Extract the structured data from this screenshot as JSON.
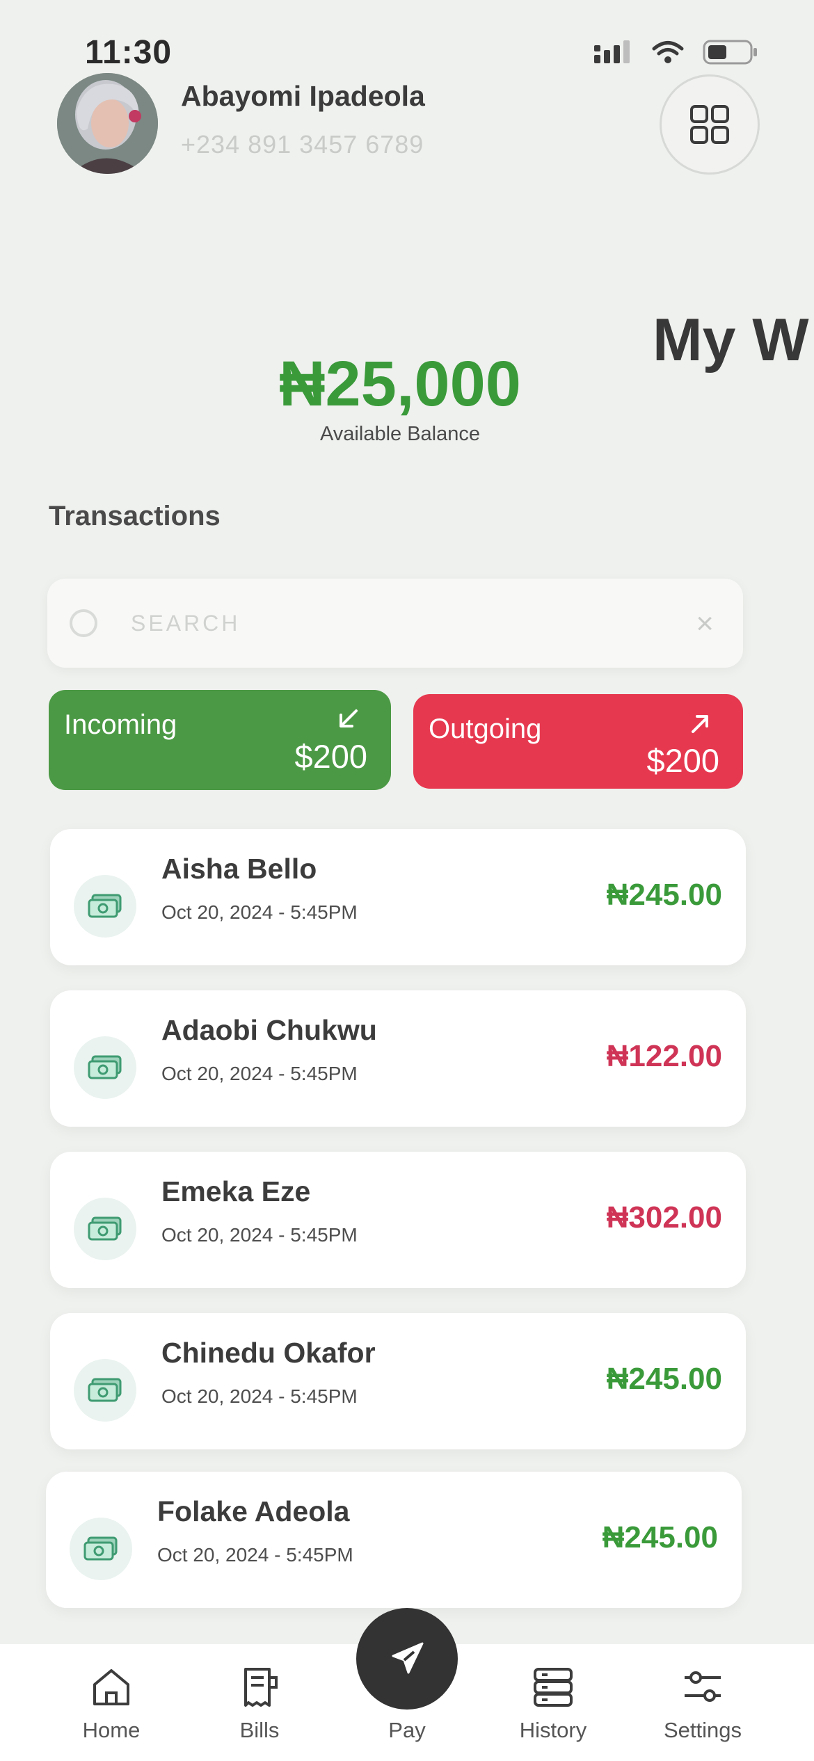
{
  "status_bar": {
    "time": "11:30",
    "icons": [
      "signal-icon",
      "wifi-icon",
      "battery-icon"
    ]
  },
  "profile": {
    "name": "Abayomi Ipadeola",
    "phone": "+234 891 3457 6789",
    "menu_icon": "grid-icon"
  },
  "wallet": {
    "peek_title": "My W",
    "balance": "₦25,000",
    "balance_label": "Available Balance"
  },
  "transactions": {
    "title": "Transactions",
    "search_placeholder": "SEARCH",
    "search_clear": "×",
    "filters": {
      "incoming": {
        "label": "Incoming",
        "amount": "$200",
        "icon": "arrow-down-left-icon"
      },
      "outgoing": {
        "label": "Outgoing",
        "amount": "$200",
        "icon": "arrow-up-right-icon"
      }
    },
    "items": [
      {
        "name": "Aisha Bello",
        "date": "Oct 20, 2024 - 5:45PM",
        "amount": "₦245.00",
        "direction": "incoming"
      },
      {
        "name": "Adaobi Chukwu",
        "date": "Oct 20, 2024 - 5:45PM",
        "amount": "₦122.00",
        "direction": "outgoing"
      },
      {
        "name": "Emeka Eze",
        "date": "Oct 20, 2024 - 5:45PM",
        "amount": "₦302.00",
        "direction": "outgoing"
      },
      {
        "name": "Chinedu Okafor",
        "date": "Oct 20, 2024 - 5:45PM",
        "amount": "₦245.00",
        "direction": "incoming"
      },
      {
        "name": "Folake Adeola",
        "date": "Oct 20, 2024 - 5:45PM",
        "amount": "₦245.00",
        "direction": "incoming"
      }
    ]
  },
  "nav": {
    "home": "Home",
    "bills": "Bills",
    "pay": "Pay",
    "history": "History",
    "settings": "Settings"
  },
  "colors": {
    "accent_green": "#3a9a3a",
    "incoming_bg": "#4c9945",
    "outgoing_bg": "#e63950",
    "negative_text": "#cf3456",
    "background": "#eff1ee"
  }
}
